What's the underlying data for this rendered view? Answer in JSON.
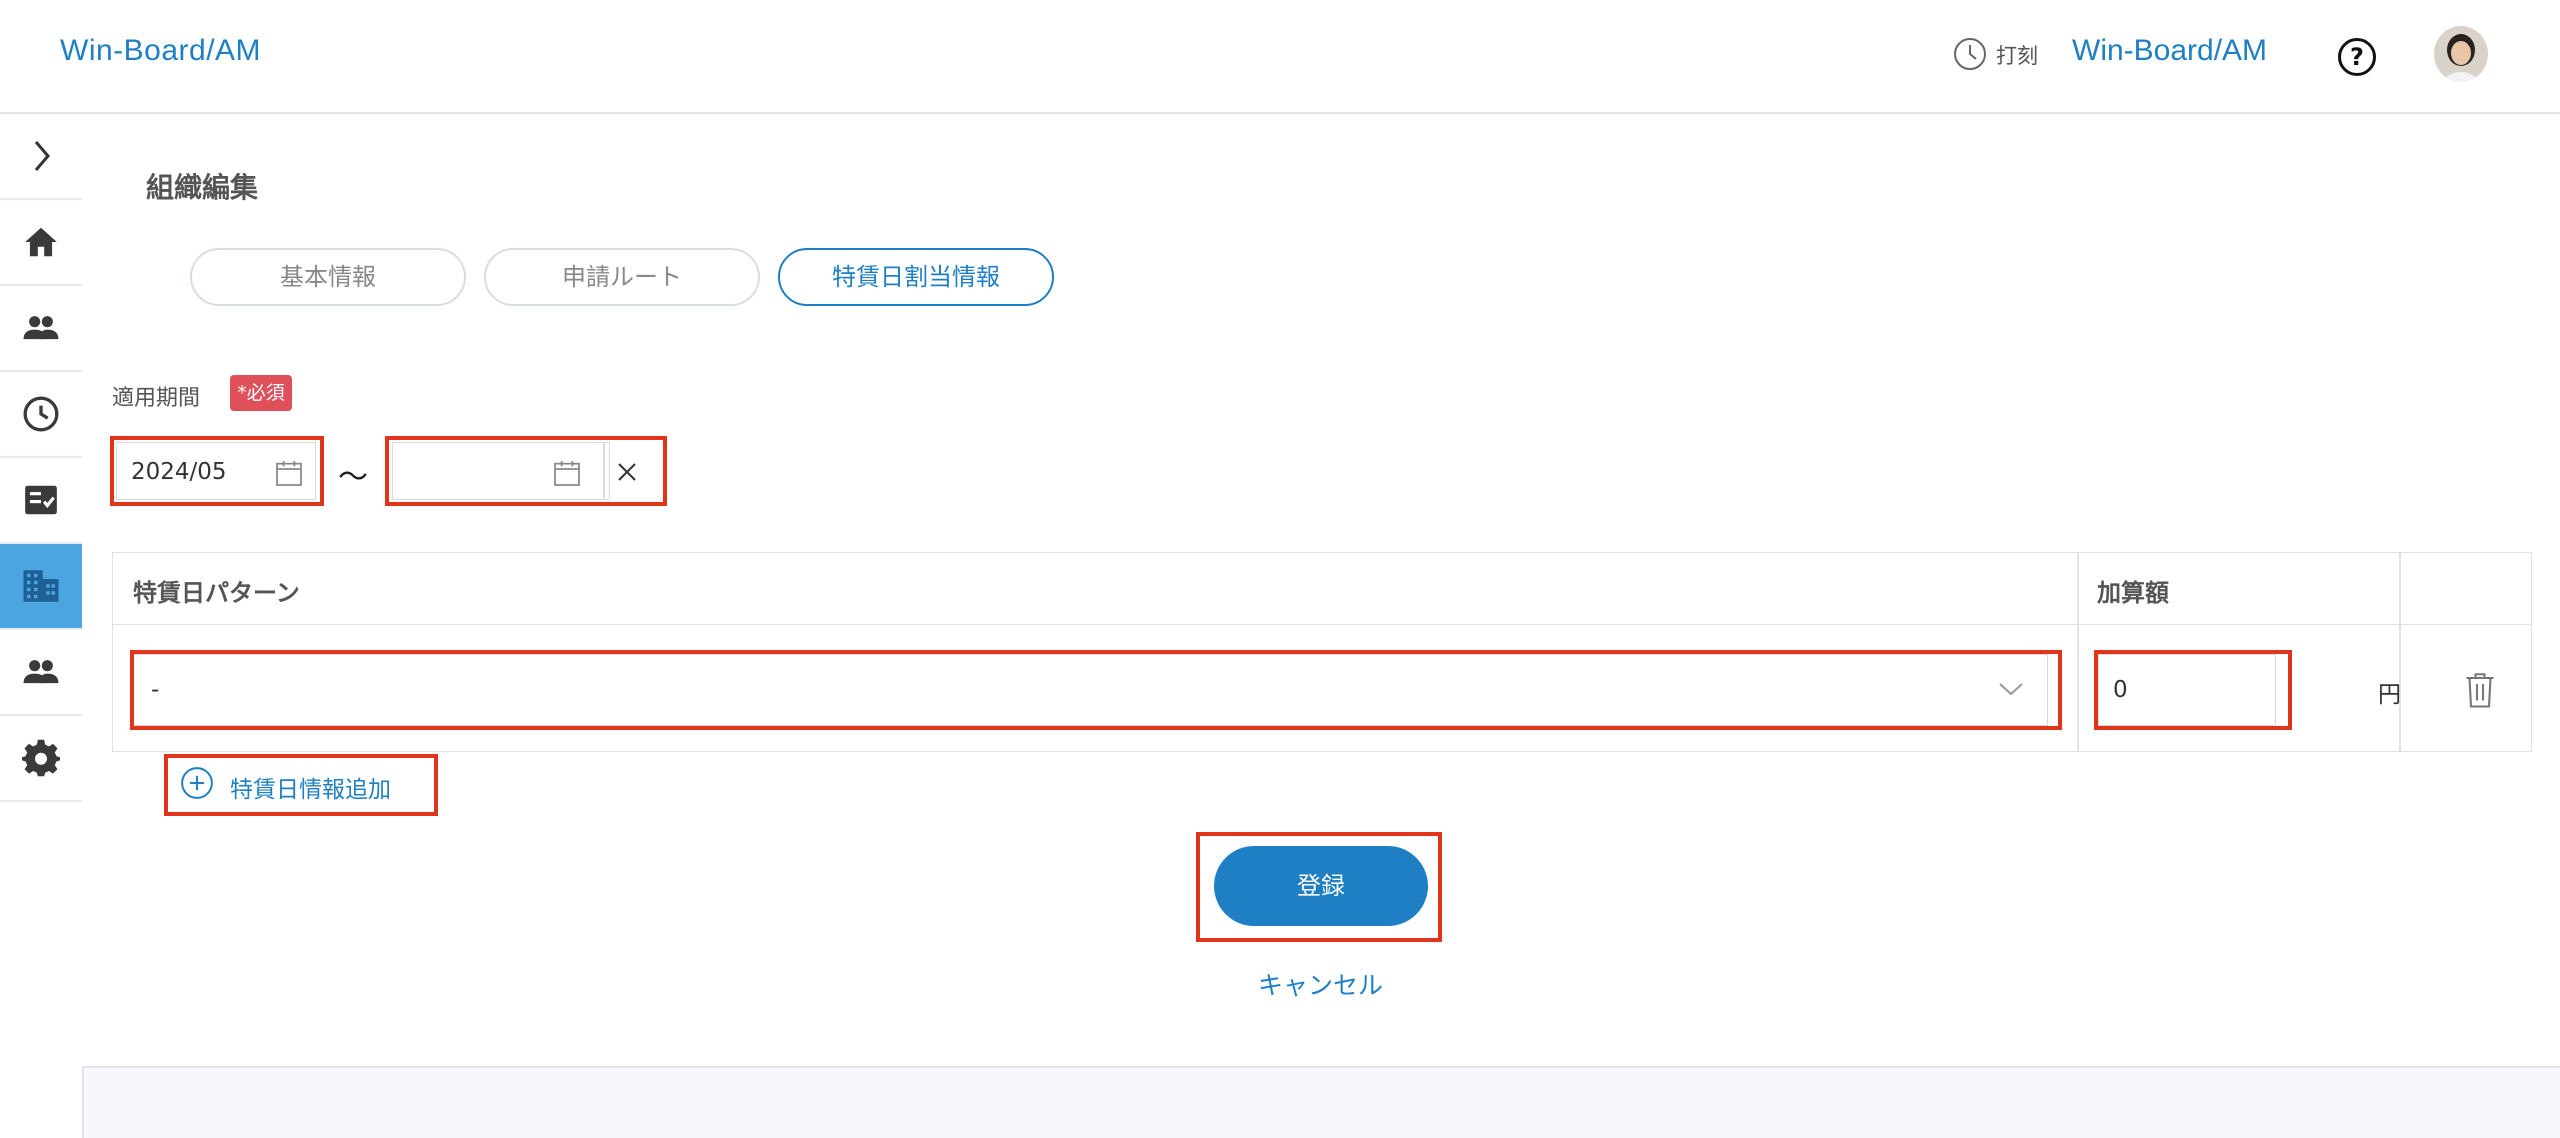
{
  "header": {
    "brand": "Win-Board/AM",
    "punch_label": "打刻",
    "brand_right": "Win-Board/AM",
    "help_symbol": "?"
  },
  "sidebar": {
    "toggle_icon": "chevron-right-icon",
    "items": [
      {
        "icon": "home-icon"
      },
      {
        "icon": "people-icon"
      },
      {
        "icon": "clock-icon"
      },
      {
        "icon": "checklist-icon"
      },
      {
        "icon": "building-icon",
        "active": true
      },
      {
        "icon": "group-icon"
      },
      {
        "icon": "gear-icon"
      }
    ]
  },
  "page": {
    "title": "組織編集",
    "tabs": [
      {
        "label": "基本情報"
      },
      {
        "label": "申請ルート"
      },
      {
        "label": "特賃日割当情報",
        "active": true
      }
    ],
    "period_label": "適用期間",
    "required_badge": "*必須",
    "start_date": "2024/05",
    "end_date": "",
    "tilde": "〜",
    "table": {
      "col_pattern": "特賃日パターン",
      "col_amount": "加算額",
      "rows": [
        {
          "pattern": "-",
          "amount": "0",
          "unit": "円"
        }
      ]
    },
    "add_link": "特賃日情報追加",
    "submit_label": "登録",
    "cancel_label": "キャンセル"
  },
  "colors": {
    "accent": "#1e7fc4",
    "active_sidebar": "#4aa5e0",
    "required": "#e0505a",
    "highlight": "#e0341c"
  }
}
